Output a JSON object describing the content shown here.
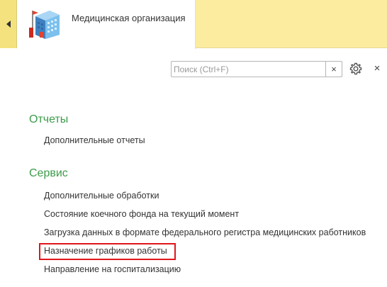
{
  "topbar": {
    "org_tab": {
      "title": "Медицинская организация",
      "icon": "building-icon"
    },
    "collapse_icon": "triangle-left-icon",
    "colors": {
      "background": "#fbec9f",
      "tab": "#ffffff"
    }
  },
  "search": {
    "placeholder": "Поиск (Ctrl+F)",
    "value": "",
    "clear_label": "×"
  },
  "toolbar": {
    "settings_icon": "gear-icon",
    "close_label": "×"
  },
  "sections": [
    {
      "title": "Отчеты",
      "items": [
        "Дополнительные отчеты"
      ]
    },
    {
      "title": "Сервис",
      "items": [
        "Дополнительные обработки",
        "Состояние коечного фонда на текущий момент",
        "Загрузка данных в формате федерального регистра медицинских работников",
        "Назначение графиков работы",
        "Направление на госпитализацию"
      ]
    }
  ],
  "highlighted_item": "Назначение графиков работы",
  "colors": {
    "section_title": "#3d9b4b",
    "highlight_border": "#e0161b"
  }
}
